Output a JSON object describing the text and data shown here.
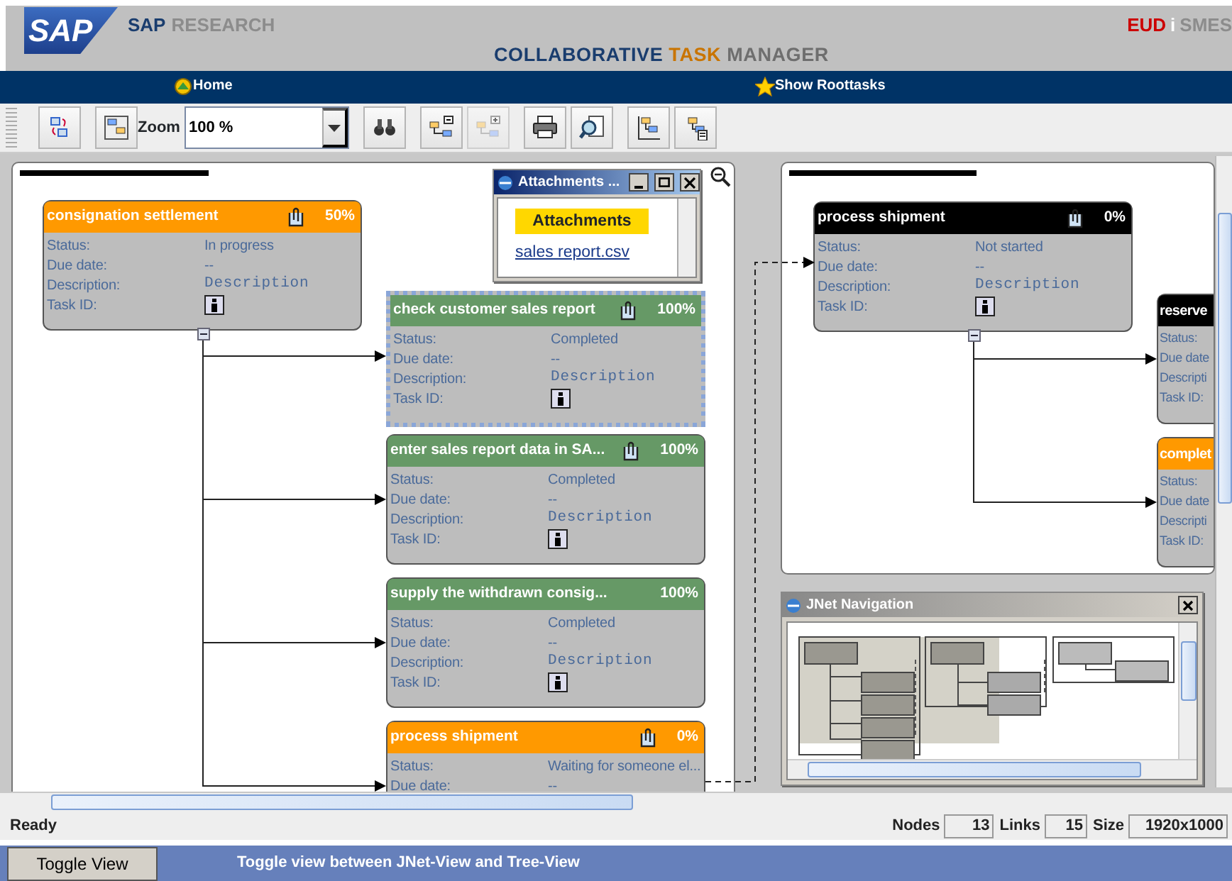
{
  "header": {
    "logo": "SAP",
    "brand": [
      "SAP",
      "RESEARCH"
    ],
    "partner": [
      "EUD",
      "i",
      "SMES"
    ],
    "title": [
      "COLLABORATIVE",
      "TASK",
      "MANAGER"
    ]
  },
  "nav": [
    {
      "kind": "home",
      "label": "Home"
    },
    {
      "kind": "star",
      "label": "Show Roottasks"
    }
  ],
  "toolbar": [
    {
      "kind": "swap",
      "disabled": false
    },
    {
      "kind": "layout",
      "disabled": false
    },
    {
      "kind": "zoom",
      "label": "Zoom",
      "value": "100 %",
      "disabled": false
    },
    {
      "kind": "find",
      "disabled": false
    },
    {
      "kind": "collapse",
      "disabled": false
    },
    {
      "kind": "expand",
      "disabled": true
    },
    {
      "kind": "print",
      "disabled": false
    },
    {
      "kind": "preview",
      "disabled": false
    },
    {
      "kind": "tree",
      "disabled": false
    },
    {
      "kind": "treedoc",
      "disabled": false
    }
  ],
  "panels": [
    {
      "root": {
        "title": "consignation settlement",
        "color": "#ff9900",
        "percent": "50%",
        "attachment": true,
        "selected": false,
        "fields": [
          {
            "label": "Status:",
            "value": "In progress"
          },
          {
            "label": "Due date:",
            "value": "--"
          },
          {
            "label": "Description:",
            "value": "Description",
            "kind": "mono"
          },
          {
            "label": "Task ID:",
            "kind": "info"
          }
        ],
        "children": [
          {
            "kind": "full",
            "title": "check customer sales report",
            "color": "#669966",
            "percent": "100%",
            "attachment": true,
            "selected": true,
            "fields": [
              {
                "label": "Status:",
                "value": "Completed"
              },
              {
                "label": "Due date:",
                "value": "--"
              },
              {
                "label": "Description:",
                "value": "Description",
                "kind": "mono"
              },
              {
                "label": "Task ID:",
                "kind": "info"
              }
            ]
          },
          {
            "kind": "full",
            "title": "enter sales report data in SA...",
            "color": "#669966",
            "percent": "100%",
            "attachment": true,
            "selected": false,
            "fields": [
              {
                "label": "Status:",
                "value": "Completed"
              },
              {
                "label": "Due date:",
                "value": "--"
              },
              {
                "label": "Description:",
                "value": "Description",
                "kind": "mono"
              },
              {
                "label": "Task ID:",
                "kind": "info"
              }
            ]
          },
          {
            "kind": "full",
            "title": "supply the withdrawn consig...",
            "color": "#669966",
            "percent": "100%",
            "attachment": false,
            "selected": false,
            "fields": [
              {
                "label": "Status:",
                "value": "Completed"
              },
              {
                "label": "Due date:",
                "value": "--"
              },
              {
                "label": "Description:",
                "value": "Description",
                "kind": "mono"
              },
              {
                "label": "Task ID:",
                "kind": "info"
              }
            ]
          },
          {
            "kind": "full",
            "title": "process shipment",
            "color": "#ff9900",
            "percent": "0%",
            "attachment": true,
            "selected": false,
            "fields": [
              {
                "label": "Status:",
                "value": "Waiting for someone el..."
              },
              {
                "label": "Due date:",
                "value": "--"
              }
            ]
          }
        ]
      }
    },
    {
      "root": {
        "title": "process shipment",
        "color": "#000000",
        "percent": "0%",
        "attachment": true,
        "selected": false,
        "fields": [
          {
            "label": "Status:",
            "value": "Not started"
          },
          {
            "label": "Due date:",
            "value": "--"
          },
          {
            "label": "Description:",
            "value": "Description",
            "kind": "mono"
          },
          {
            "label": "Task ID:",
            "kind": "info"
          }
        ],
        "children": [
          {
            "kind": "partial",
            "title": "reserve",
            "color": "#000000",
            "selected": false,
            "fields": [
              {
                "label": "Status:"
              },
              {
                "label": "Due date"
              },
              {
                "label": "Descripti"
              },
              {
                "label": "Task ID:"
              }
            ]
          },
          {
            "kind": "partial",
            "title": "complet",
            "color": "#ff9900",
            "selected": false,
            "fields": [
              {
                "label": "Status:"
              },
              {
                "label": "Due date"
              },
              {
                "label": "Descripti"
              },
              {
                "label": "Task ID:"
              }
            ]
          }
        ]
      }
    }
  ],
  "attachments_window": {
    "title": "Attachments ...",
    "heading": "Attachments",
    "link": "sales report.csv"
  },
  "navigation_window": {
    "title": "JNet Navigation"
  },
  "status_bar": {
    "text": "Ready",
    "stats": [
      {
        "label": "Nodes",
        "value": "13"
      },
      {
        "label": "Links",
        "value": "15"
      },
      {
        "label": "Size",
        "value": "1920x1000"
      }
    ]
  },
  "footer": {
    "button": "Toggle View",
    "hint": "Toggle view between JNet-View and Tree-View"
  }
}
